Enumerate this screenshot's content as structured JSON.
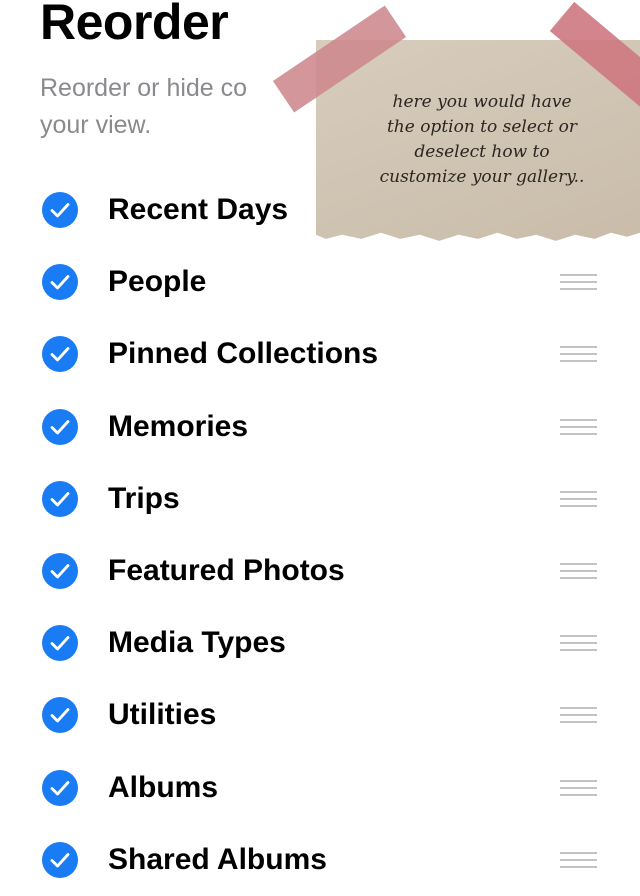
{
  "header": {
    "title": "Reorder",
    "subtitle_line1": "Reorder or hide co",
    "subtitle_line2": "your view."
  },
  "sticky_note": {
    "lines": [
      "here you would have",
      "the option to select or",
      "deselect how to",
      "customize your gallery.."
    ]
  },
  "colors": {
    "accent": "#1a7cf4",
    "subtitle": "#8a8a8e",
    "handle": "#c3c3c7",
    "note_paper": "#d2c6b5",
    "tape": "#cd878c"
  },
  "items": [
    {
      "label": "Recent Days",
      "checked": true,
      "icon": "checkmark-circle-icon",
      "handle": false
    },
    {
      "label": "People",
      "checked": true,
      "icon": "checkmark-circle-icon",
      "handle": true
    },
    {
      "label": "Pinned Collections",
      "checked": true,
      "icon": "checkmark-circle-icon",
      "handle": true
    },
    {
      "label": "Memories",
      "checked": true,
      "icon": "checkmark-circle-icon",
      "handle": true
    },
    {
      "label": "Trips",
      "checked": true,
      "icon": "checkmark-circle-icon",
      "handle": true
    },
    {
      "label": "Featured Photos",
      "checked": true,
      "icon": "checkmark-circle-icon",
      "handle": true
    },
    {
      "label": "Media Types",
      "checked": true,
      "icon": "checkmark-circle-icon",
      "handle": true
    },
    {
      "label": "Utilities",
      "checked": true,
      "icon": "checkmark-circle-icon",
      "handle": true
    },
    {
      "label": "Albums",
      "checked": true,
      "icon": "checkmark-circle-icon",
      "handle": true
    },
    {
      "label": "Shared Albums",
      "checked": true,
      "icon": "checkmark-circle-icon",
      "handle": true
    }
  ]
}
